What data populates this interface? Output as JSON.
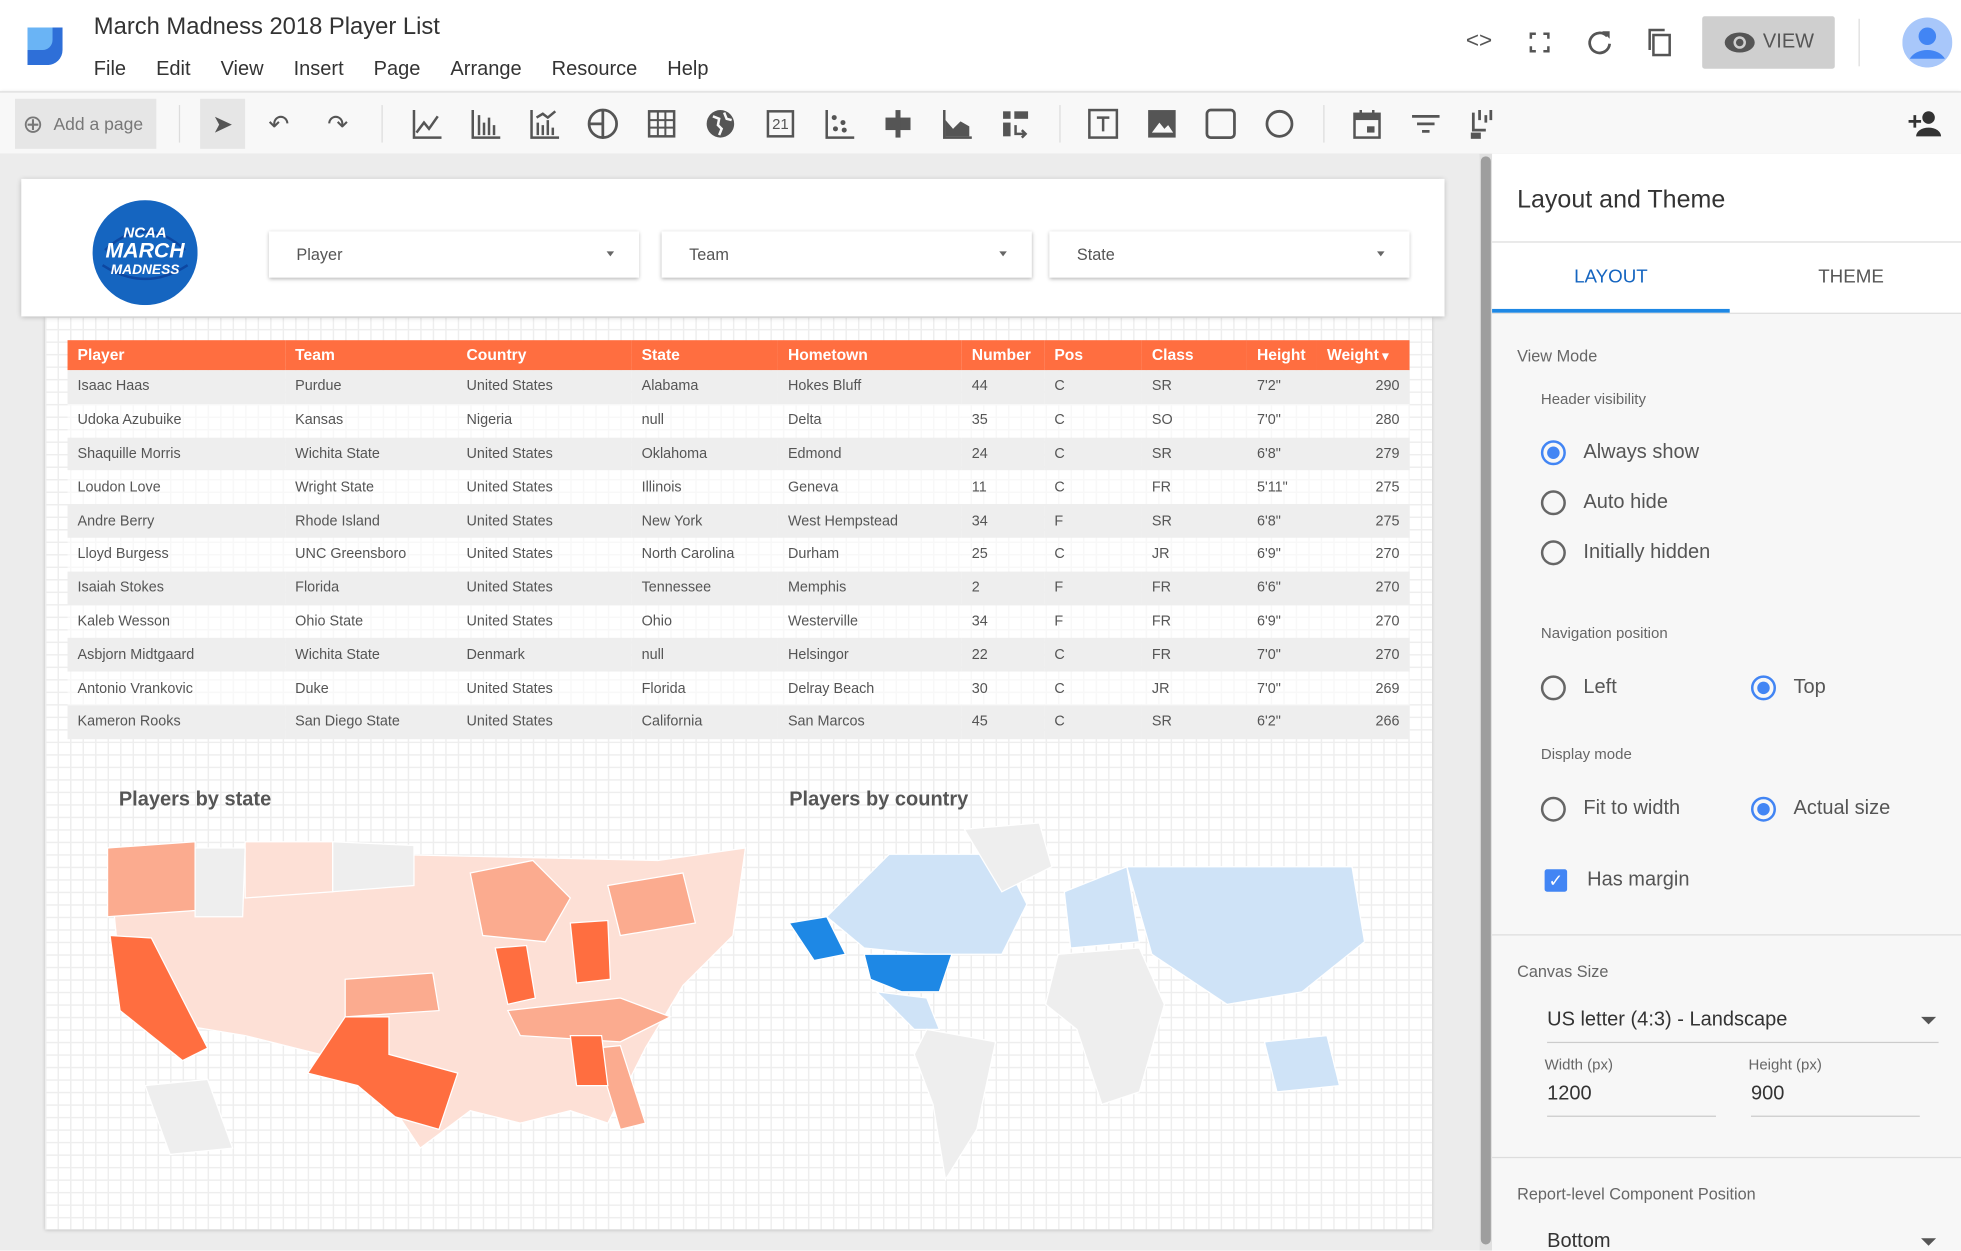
{
  "app": {
    "title": "March Madness 2018 Player List",
    "menu": [
      "File",
      "Edit",
      "View",
      "Insert",
      "Page",
      "Arrange",
      "Resource",
      "Help"
    ]
  },
  "header_actions": {
    "view_label": "VIEW"
  },
  "toolbar": {
    "add_page_label": "Add a page",
    "icons": [
      "select-icon",
      "undo-icon",
      "redo-icon",
      "time-series-icon",
      "bar-chart-icon",
      "combo-chart-icon",
      "pie-chart-icon",
      "table-icon",
      "geo-map-icon",
      "scorecard-icon",
      "scatter-chart-icon",
      "bullet-chart-icon",
      "area-chart-icon",
      "pivot-table-icon",
      "text-icon",
      "image-icon",
      "rectangle-icon",
      "circle-icon",
      "date-range-icon",
      "filter-control-icon",
      "data-control-icon"
    ],
    "scorecard_glyph": "21"
  },
  "logo_text": [
    "NCAA",
    "MARCH",
    "MADNESS"
  ],
  "filters": [
    {
      "label": "Player"
    },
    {
      "label": "Team"
    },
    {
      "label": "State"
    }
  ],
  "table": {
    "columns": [
      "Player",
      "Team",
      "Country",
      "State",
      "Hometown",
      "Number",
      "Pos",
      "Class",
      "Height",
      "Weight"
    ],
    "sort_column": "Weight",
    "rows": [
      [
        "Isaac Haas",
        "Purdue",
        "United States",
        "Alabama",
        "Hokes Bluff",
        "44",
        "C",
        "SR",
        "7'2\"",
        "290"
      ],
      [
        "Udoka Azubuike",
        "Kansas",
        "Nigeria",
        "null",
        "Delta",
        "35",
        "C",
        "SO",
        "7'0\"",
        "280"
      ],
      [
        "Shaquille Morris",
        "Wichita State",
        "United States",
        "Oklahoma",
        "Edmond",
        "24",
        "C",
        "SR",
        "6'8\"",
        "279"
      ],
      [
        "Loudon Love",
        "Wright State",
        "United States",
        "Illinois",
        "Geneva",
        "11",
        "C",
        "FR",
        "5'11\"",
        "275"
      ],
      [
        "Andre Berry",
        "Rhode Island",
        "United States",
        "New York",
        "West Hempstead",
        "34",
        "F",
        "SR",
        "6'8\"",
        "275"
      ],
      [
        "Lloyd Burgess",
        "UNC Greensboro",
        "United States",
        "North Carolina",
        "Durham",
        "25",
        "C",
        "JR",
        "6'9\"",
        "270"
      ],
      [
        "Isaiah Stokes",
        "Florida",
        "United States",
        "Tennessee",
        "Memphis",
        "2",
        "F",
        "FR",
        "6'6\"",
        "270"
      ],
      [
        "Kaleb Wesson",
        "Ohio State",
        "United States",
        "Ohio",
        "Westerville",
        "34",
        "F",
        "FR",
        "6'9\"",
        "270"
      ],
      [
        "Asbjorn Midtgaard",
        "Wichita State",
        "Denmark",
        "null",
        "Helsingor",
        "22",
        "C",
        "FR",
        "7'0\"",
        "270"
      ],
      [
        "Antonio Vrankovic",
        "Duke",
        "United States",
        "Florida",
        "Delray Beach",
        "30",
        "C",
        "JR",
        "7'0\"",
        "269"
      ],
      [
        "Kameron Rooks",
        "San Diego State",
        "United States",
        "California",
        "San Marcos",
        "45",
        "C",
        "SR",
        "6'2\"",
        "266"
      ]
    ]
  },
  "maps": {
    "state_title": "Players by state",
    "country_title": "Players by country",
    "colors": {
      "state_max": "#ff6e40",
      "state_mid": "#fbab8f",
      "state_low": "#fde0d6",
      "country_max": "#1e88e5",
      "country_low": "#cfe3f7",
      "no_data": "#eeeeee"
    }
  },
  "panel": {
    "title": "Layout and Theme",
    "tabs": [
      "LAYOUT",
      "THEME"
    ],
    "active_tab": "LAYOUT",
    "view_mode_label": "View Mode",
    "header_visibility_label": "Header visibility",
    "header_visibility_options": [
      "Always show",
      "Auto hide",
      "Initially hidden"
    ],
    "header_visibility_selected": "Always show",
    "nav_position_label": "Navigation position",
    "nav_options": [
      "Left",
      "Top"
    ],
    "nav_selected": "Top",
    "display_mode_label": "Display mode",
    "display_options": [
      "Fit to width",
      "Actual size"
    ],
    "display_selected": "Actual size",
    "has_margin_label": "Has margin",
    "has_margin": true,
    "canvas_size_label": "Canvas Size",
    "canvas_size_value": "US letter (4:3) - Landscape",
    "width_label": "Width (px)",
    "width_value": "1200",
    "height_label": "Height (px)",
    "height_value": "900",
    "component_position_label": "Report-level Component Position",
    "component_position_value": "Bottom"
  }
}
